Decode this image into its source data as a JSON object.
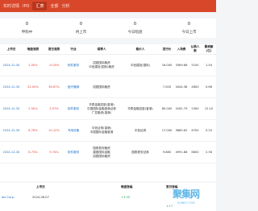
{
  "topbar": {
    "items": [
      "实时详情",
      "IPO",
      "汇表",
      "全部",
      "分析"
    ],
    "active_index": 2
  },
  "stats": [
    {
      "value": "0",
      "label": "申购中"
    },
    {
      "value": "0",
      "label": "待上市"
    },
    {
      "value": "0",
      "label": "今日暗盘"
    },
    {
      "value": "0",
      "label": "今日上市"
    }
  ],
  "table": {
    "headers": [
      "上市日",
      "暗盘涨跌",
      "首日涨跌",
      "行业",
      "保荐人",
      "稳价人",
      "发行价",
      "入场费",
      "认购人数",
      "募资额(亿)"
    ],
    "rows": [
      {
        "date": "2024-12-30",
        "dark": "2.00%",
        "first": "-5.00%",
        "industry": "软件服务",
        "sponsor": "招银国际融资\n中信建投(国际)融资",
        "stab": "中信建投(国际)",
        "price": "16.000",
        "fee": "3369.66",
        "subs": "5100",
        "raise": "1.54"
      },
      {
        "date": "2024-12-30",
        "dark": "22.00%",
        "first": "36.67%",
        "industry": "医疗器械",
        "sponsor": "招银国际融资",
        "stab": "",
        "price": "7.000",
        "fee": "4444.38",
        "subs": "4800",
        "raise": "0.66"
      },
      {
        "date": "2024-12-30",
        "dark": "2.50%",
        "first": "3.57%",
        "industry": "软件服务",
        "sponsor": "华泰金融控股(香港)\n中国国际金融香港证券\n广发融资(香港)",
        "stab": "华泰金融控股(香港)",
        "price": "80.000",
        "fee": "4161.79",
        "subs": "2300",
        "raise": "12.10"
      },
      {
        "date": "2024-12-30",
        "dark": "8.76%",
        "first": "10.12%",
        "industry": "专用设备",
        "sponsor": "中信证券(香港)\n中国国际金融香港",
        "stab": "中信证券",
        "price": "17.000",
        "fee": "3880.62",
        "subs": "6700",
        "raise": "5.20"
      },
      {
        "date": "2024-12-30",
        "dark": "8.73%",
        "first": "9.74%",
        "industry": "软件服务",
        "sponsor": "国泰君安融资\n建银国际金融\n招银国际融资",
        "stab": "国泰君安证券",
        "price": "9.880",
        "fee": "4991.88",
        "subs": "6800",
        "raise": "2.58"
      }
    ]
  },
  "lower": {
    "headers": [
      "上市日",
      "暗盘涨幅",
      "首日涨幅"
    ],
    "rows": [
      {
        "name": "ale Corp.",
        "date": "2024-06-07",
        "dark": "+3.50",
        "first": ""
      },
      {
        "name": "",
        "date": "",
        "dark": "",
        "first": "1.17"
      }
    ]
  },
  "watermark": {
    "text": "聚集网",
    "sub": "JUJINET.COM"
  }
}
